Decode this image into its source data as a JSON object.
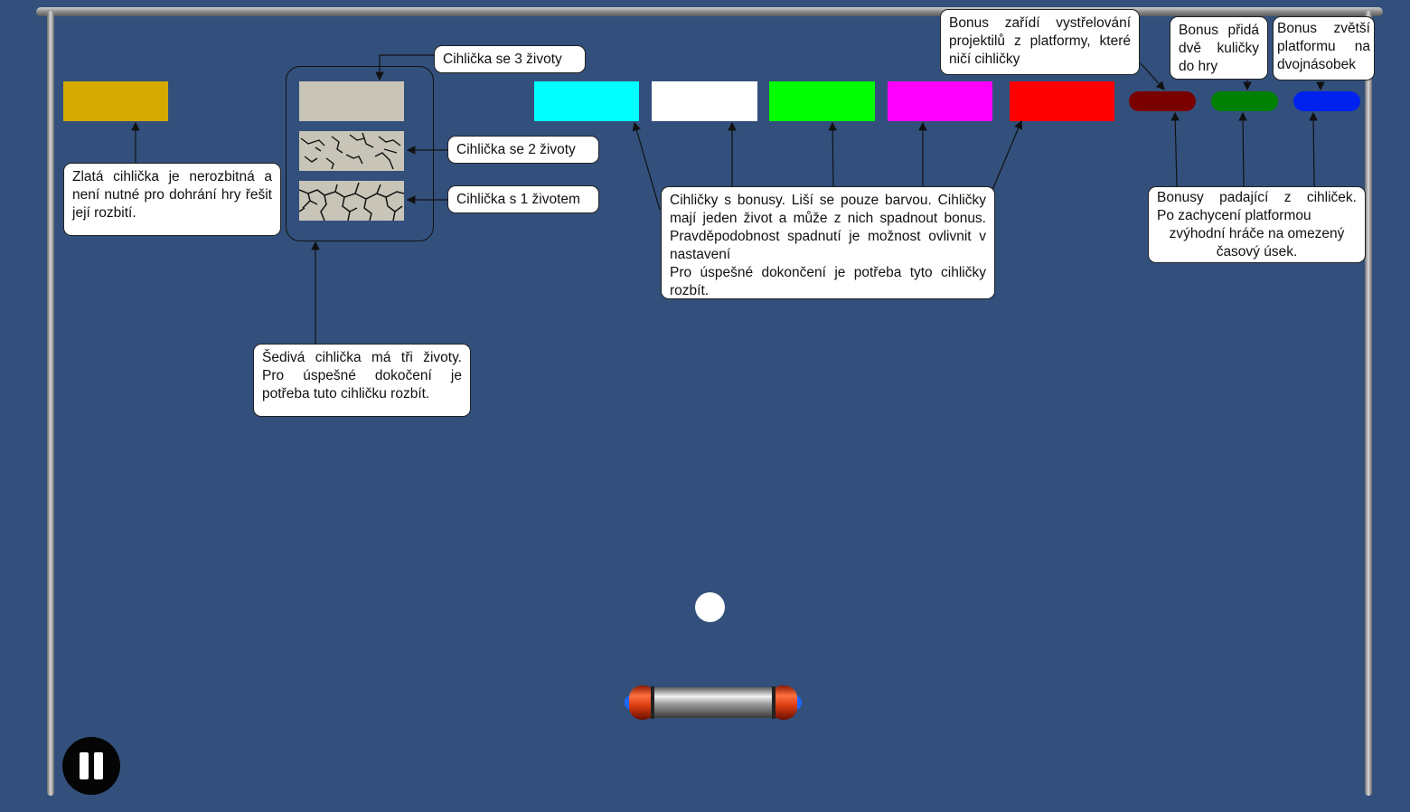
{
  "game": {
    "background_color": "#33507c",
    "bricks": {
      "gold": {
        "color": "#d4aa00",
        "lives": "unbreakable"
      },
      "gray": {
        "color": "#c8c4b8",
        "lives": 3
      },
      "bonus_bricks": [
        {
          "name": "cyan-brick",
          "color": "#00ffff"
        },
        {
          "name": "white-brick",
          "color": "#ffffff"
        },
        {
          "name": "green-brick",
          "color": "#00ff00"
        },
        {
          "name": "magenta-brick",
          "color": "#ff00ff"
        },
        {
          "name": "red-brick",
          "color": "#ff0000"
        }
      ]
    },
    "bonuses": [
      {
        "name": "projectile-bonus",
        "color": "#7a0000"
      },
      {
        "name": "multiball-bonus",
        "color": "#008000"
      },
      {
        "name": "enlarge-bonus",
        "color": "#0022ee"
      }
    ],
    "ball_color": "#ffffff",
    "pause_icon": "pause-icon"
  },
  "labels": {
    "gold_brick": "Zlatá cihlička je nerozbitná a není nutné pro dohrání hry řešit její rozbití.",
    "lives_3": "Cihlička se 3 životy",
    "lives_2": "Cihlička se 2 životy",
    "lives_1": "Cihlička s 1 životem",
    "gray_brick": "Šedivá cihlička má tři životy. Pro úspešné dokočení je potřeba tuto cihličku rozbít.",
    "bonus_bricks": "Cihličky s bonusy. Liší se pouze barvou. Cihličky mají jeden život a může z nich spadnout bonus. Pravděpodobnost spadnutí je možnost ovlivnit v nastavení",
    "bonus_bricks_2": "Pro úspešné dokončení je potřeba tyto cihličky rozbít.",
    "projectile_bonus": "Bonus zařídí vystřelování projektilů z platformy, které ničí cihličky",
    "multiball_bonus": "Bonus přidá dvě kuličky do hry",
    "enlarge_bonus": "Bonus zvětší platformu na dvojnásobek",
    "falling_bonuses_1": "Bonusy padající z cihliček.",
    "falling_bonuses_2": "Po zachycení platformou",
    "falling_bonuses_3": "zvýhodní hráče na omezený",
    "falling_bonuses_4": "časový úsek."
  }
}
